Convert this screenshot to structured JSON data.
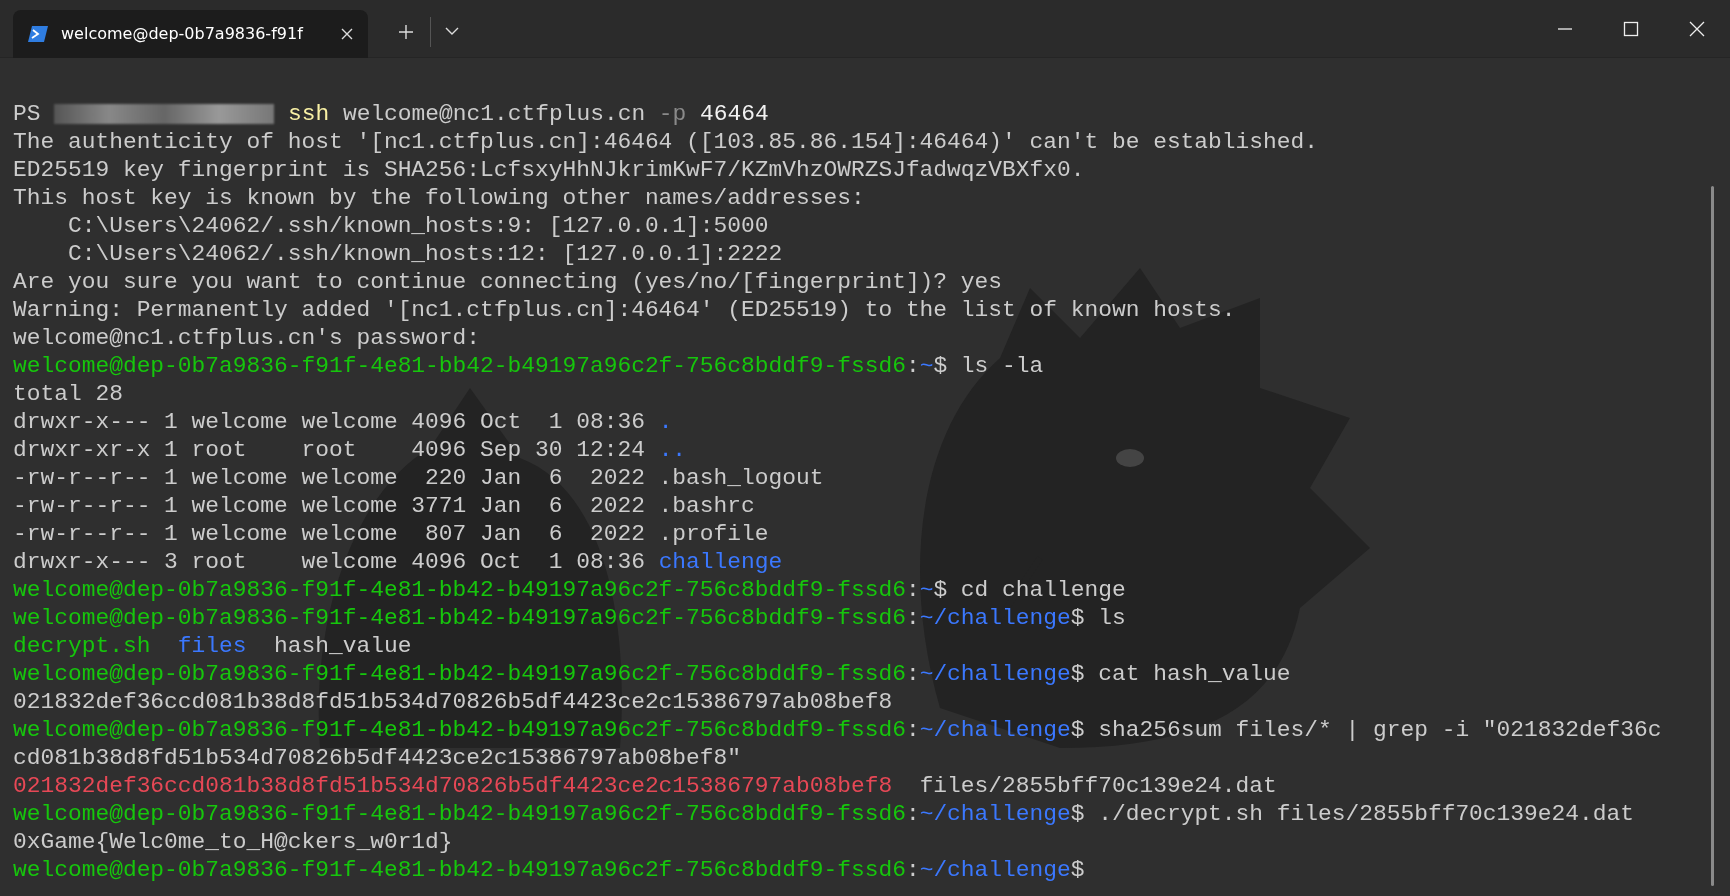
{
  "tabs": [
    {
      "title": "welcome@dep-0b7a9836-f91f",
      "selected": true
    }
  ],
  "terminal": {
    "lines": [
      [
        {
          "kind": "text",
          "text": "PS "
        },
        {
          "kind": "redacted"
        },
        {
          "kind": "command",
          "text": " ssh"
        },
        {
          "kind": "text",
          "text": " welcome@nc1.ctfplus.cn"
        },
        {
          "kind": "flag",
          "text": " -p"
        },
        {
          "kind": "bright",
          "text": " 46464"
        }
      ],
      [
        {
          "kind": "text",
          "text": "The authenticity of host '[nc1.ctfplus.cn]:46464 ([103.85.86.154]:46464)' can't be established."
        }
      ],
      [
        {
          "kind": "text",
          "text": "ED25519 key fingerprint is SHA256:LcfsxyHhNJkrimKwF7/KZmVhzOWRZSJfadwqzVBXfx0."
        }
      ],
      [
        {
          "kind": "text",
          "text": "This host key is known by the following other names/addresses:"
        }
      ],
      [
        {
          "kind": "text",
          "text": "    C:\\Users\\24062/.ssh/known_hosts:9: [127.0.0.1]:5000"
        }
      ],
      [
        {
          "kind": "text",
          "text": "    C:\\Users\\24062/.ssh/known_hosts:12: [127.0.0.1]:2222"
        }
      ],
      [
        {
          "kind": "text",
          "text": "Are you sure you want to continue connecting (yes/no/[fingerprint])? yes"
        }
      ],
      [
        {
          "kind": "text",
          "text": "Warning: Permanently added '[nc1.ctfplus.cn]:46464' (ED25519) to the list of known hosts."
        }
      ],
      [
        {
          "kind": "text",
          "text": "welcome@nc1.ctfplus.cn's password:"
        }
      ],
      [
        {
          "kind": "user",
          "text": "welcome@dep-0b7a9836-f91f-4e81-bb42-b49197a96c2f-756c8bddf9-fssd6"
        },
        {
          "kind": "text",
          "text": ":"
        },
        {
          "kind": "path",
          "text": "~"
        },
        {
          "kind": "text",
          "text": "$ ls -la"
        }
      ],
      [
        {
          "kind": "text",
          "text": "total 28"
        }
      ],
      [
        {
          "kind": "text",
          "text": "drwxr-x--- 1 welcome welcome 4096 Oct  1 08:36 "
        },
        {
          "kind": "dir",
          "text": "."
        }
      ],
      [
        {
          "kind": "text",
          "text": "drwxr-xr-x 1 root    root    4096 Sep 30 12:24 "
        },
        {
          "kind": "dir",
          "text": ".."
        }
      ],
      [
        {
          "kind": "text",
          "text": "-rw-r--r-- 1 welcome welcome  220 Jan  6  2022 .bash_logout"
        }
      ],
      [
        {
          "kind": "text",
          "text": "-rw-r--r-- 1 welcome welcome 3771 Jan  6  2022 .bashrc"
        }
      ],
      [
        {
          "kind": "text",
          "text": "-rw-r--r-- 1 welcome welcome  807 Jan  6  2022 .profile"
        }
      ],
      [
        {
          "kind": "text",
          "text": "drwxr-x--- 3 root    welcome 4096 Oct  1 08:36 "
        },
        {
          "kind": "dir",
          "text": "challenge"
        }
      ],
      [
        {
          "kind": "user",
          "text": "welcome@dep-0b7a9836-f91f-4e81-bb42-b49197a96c2f-756c8bddf9-fssd6"
        },
        {
          "kind": "text",
          "text": ":"
        },
        {
          "kind": "path",
          "text": "~"
        },
        {
          "kind": "text",
          "text": "$ cd challenge"
        }
      ],
      [
        {
          "kind": "user",
          "text": "welcome@dep-0b7a9836-f91f-4e81-bb42-b49197a96c2f-756c8bddf9-fssd6"
        },
        {
          "kind": "text",
          "text": ":"
        },
        {
          "kind": "path",
          "text": "~/challenge"
        },
        {
          "kind": "text",
          "text": "$ ls"
        }
      ],
      [
        {
          "kind": "exec",
          "text": "decrypt.sh"
        },
        {
          "kind": "dir",
          "text": "  files"
        },
        {
          "kind": "text",
          "text": "  hash_value"
        }
      ],
      [
        {
          "kind": "user",
          "text": "welcome@dep-0b7a9836-f91f-4e81-bb42-b49197a96c2f-756c8bddf9-fssd6"
        },
        {
          "kind": "text",
          "text": ":"
        },
        {
          "kind": "path",
          "text": "~/challenge"
        },
        {
          "kind": "text",
          "text": "$ cat hash_value"
        }
      ],
      [
        {
          "kind": "text",
          "text": "021832def36ccd081b38d8fd51b534d70826b5df4423ce2c15386797ab08bef8"
        }
      ],
      [
        {
          "kind": "user",
          "text": "welcome@dep-0b7a9836-f91f-4e81-bb42-b49197a96c2f-756c8bddf9-fssd6"
        },
        {
          "kind": "text",
          "text": ":"
        },
        {
          "kind": "path",
          "text": "~/challenge"
        },
        {
          "kind": "text",
          "text": "$ sha256sum files/* | grep -i \"021832def36c"
        }
      ],
      [
        {
          "kind": "text",
          "text": "cd081b38d8fd51b534d70826b5df4423ce2c15386797ab08bef8\""
        }
      ],
      [
        {
          "kind": "match",
          "text": "021832def36ccd081b38d8fd51b534d70826b5df4423ce2c15386797ab08bef8"
        },
        {
          "kind": "text",
          "text": "  files/2855bff70c139e24.dat"
        }
      ],
      [
        {
          "kind": "user",
          "text": "welcome@dep-0b7a9836-f91f-4e81-bb42-b49197a96c2f-756c8bddf9-fssd6"
        },
        {
          "kind": "text",
          "text": ":"
        },
        {
          "kind": "path",
          "text": "~/challenge"
        },
        {
          "kind": "text",
          "text": "$ ./decrypt.sh files/2855bff70c139e24.dat"
        }
      ],
      [
        {
          "kind": "text",
          "text": "0xGame{Welc0me_to_H@ckers_w0r1d}"
        }
      ],
      [
        {
          "kind": "user",
          "text": "welcome@dep-0b7a9836-f91f-4e81-bb42-b49197a96c2f-756c8bddf9-fssd6"
        },
        {
          "kind": "text",
          "text": ":"
        },
        {
          "kind": "path",
          "text": "~/challenge"
        },
        {
          "kind": "text",
          "text": "$"
        }
      ]
    ]
  }
}
